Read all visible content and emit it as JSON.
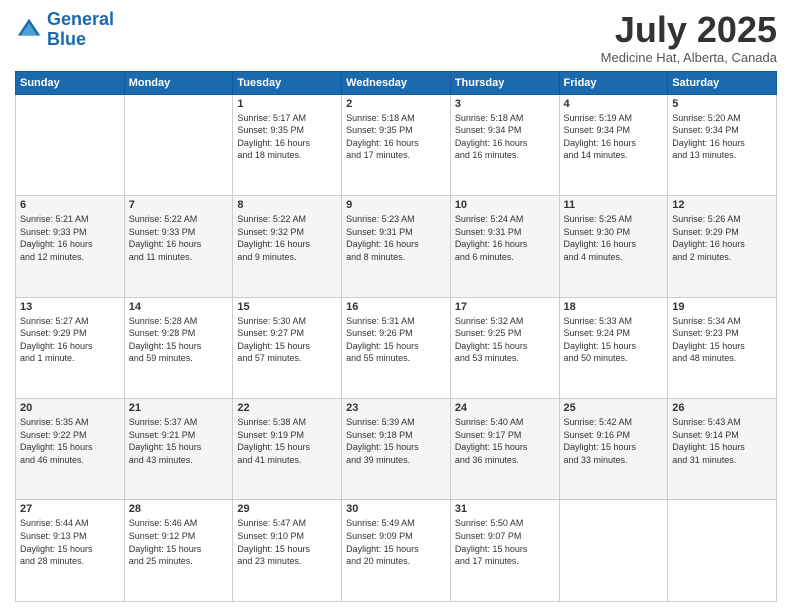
{
  "header": {
    "logo_general": "General",
    "logo_blue": "Blue",
    "month_title": "July 2025",
    "location": "Medicine Hat, Alberta, Canada"
  },
  "weekdays": [
    "Sunday",
    "Monday",
    "Tuesday",
    "Wednesday",
    "Thursday",
    "Friday",
    "Saturday"
  ],
  "weeks": [
    [
      {
        "day": "",
        "text": ""
      },
      {
        "day": "",
        "text": ""
      },
      {
        "day": "1",
        "text": "Sunrise: 5:17 AM\nSunset: 9:35 PM\nDaylight: 16 hours\nand 18 minutes."
      },
      {
        "day": "2",
        "text": "Sunrise: 5:18 AM\nSunset: 9:35 PM\nDaylight: 16 hours\nand 17 minutes."
      },
      {
        "day": "3",
        "text": "Sunrise: 5:18 AM\nSunset: 9:34 PM\nDaylight: 16 hours\nand 16 minutes."
      },
      {
        "day": "4",
        "text": "Sunrise: 5:19 AM\nSunset: 9:34 PM\nDaylight: 16 hours\nand 14 minutes."
      },
      {
        "day": "5",
        "text": "Sunrise: 5:20 AM\nSunset: 9:34 PM\nDaylight: 16 hours\nand 13 minutes."
      }
    ],
    [
      {
        "day": "6",
        "text": "Sunrise: 5:21 AM\nSunset: 9:33 PM\nDaylight: 16 hours\nand 12 minutes."
      },
      {
        "day": "7",
        "text": "Sunrise: 5:22 AM\nSunset: 9:33 PM\nDaylight: 16 hours\nand 11 minutes."
      },
      {
        "day": "8",
        "text": "Sunrise: 5:22 AM\nSunset: 9:32 PM\nDaylight: 16 hours\nand 9 minutes."
      },
      {
        "day": "9",
        "text": "Sunrise: 5:23 AM\nSunset: 9:31 PM\nDaylight: 16 hours\nand 8 minutes."
      },
      {
        "day": "10",
        "text": "Sunrise: 5:24 AM\nSunset: 9:31 PM\nDaylight: 16 hours\nand 6 minutes."
      },
      {
        "day": "11",
        "text": "Sunrise: 5:25 AM\nSunset: 9:30 PM\nDaylight: 16 hours\nand 4 minutes."
      },
      {
        "day": "12",
        "text": "Sunrise: 5:26 AM\nSunset: 9:29 PM\nDaylight: 16 hours\nand 2 minutes."
      }
    ],
    [
      {
        "day": "13",
        "text": "Sunrise: 5:27 AM\nSunset: 9:29 PM\nDaylight: 16 hours\nand 1 minute."
      },
      {
        "day": "14",
        "text": "Sunrise: 5:28 AM\nSunset: 9:28 PM\nDaylight: 15 hours\nand 59 minutes."
      },
      {
        "day": "15",
        "text": "Sunrise: 5:30 AM\nSunset: 9:27 PM\nDaylight: 15 hours\nand 57 minutes."
      },
      {
        "day": "16",
        "text": "Sunrise: 5:31 AM\nSunset: 9:26 PM\nDaylight: 15 hours\nand 55 minutes."
      },
      {
        "day": "17",
        "text": "Sunrise: 5:32 AM\nSunset: 9:25 PM\nDaylight: 15 hours\nand 53 minutes."
      },
      {
        "day": "18",
        "text": "Sunrise: 5:33 AM\nSunset: 9:24 PM\nDaylight: 15 hours\nand 50 minutes."
      },
      {
        "day": "19",
        "text": "Sunrise: 5:34 AM\nSunset: 9:23 PM\nDaylight: 15 hours\nand 48 minutes."
      }
    ],
    [
      {
        "day": "20",
        "text": "Sunrise: 5:35 AM\nSunset: 9:22 PM\nDaylight: 15 hours\nand 46 minutes."
      },
      {
        "day": "21",
        "text": "Sunrise: 5:37 AM\nSunset: 9:21 PM\nDaylight: 15 hours\nand 43 minutes."
      },
      {
        "day": "22",
        "text": "Sunrise: 5:38 AM\nSunset: 9:19 PM\nDaylight: 15 hours\nand 41 minutes."
      },
      {
        "day": "23",
        "text": "Sunrise: 5:39 AM\nSunset: 9:18 PM\nDaylight: 15 hours\nand 39 minutes."
      },
      {
        "day": "24",
        "text": "Sunrise: 5:40 AM\nSunset: 9:17 PM\nDaylight: 15 hours\nand 36 minutes."
      },
      {
        "day": "25",
        "text": "Sunrise: 5:42 AM\nSunset: 9:16 PM\nDaylight: 15 hours\nand 33 minutes."
      },
      {
        "day": "26",
        "text": "Sunrise: 5:43 AM\nSunset: 9:14 PM\nDaylight: 15 hours\nand 31 minutes."
      }
    ],
    [
      {
        "day": "27",
        "text": "Sunrise: 5:44 AM\nSunset: 9:13 PM\nDaylight: 15 hours\nand 28 minutes."
      },
      {
        "day": "28",
        "text": "Sunrise: 5:46 AM\nSunset: 9:12 PM\nDaylight: 15 hours\nand 25 minutes."
      },
      {
        "day": "29",
        "text": "Sunrise: 5:47 AM\nSunset: 9:10 PM\nDaylight: 15 hours\nand 23 minutes."
      },
      {
        "day": "30",
        "text": "Sunrise: 5:49 AM\nSunset: 9:09 PM\nDaylight: 15 hours\nand 20 minutes."
      },
      {
        "day": "31",
        "text": "Sunrise: 5:50 AM\nSunset: 9:07 PM\nDaylight: 15 hours\nand 17 minutes."
      },
      {
        "day": "",
        "text": ""
      },
      {
        "day": "",
        "text": ""
      }
    ]
  ]
}
